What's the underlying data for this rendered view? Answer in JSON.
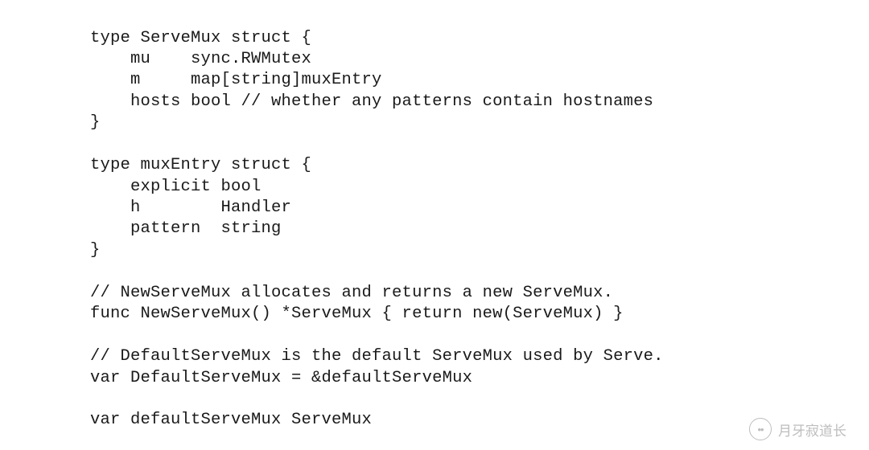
{
  "code": {
    "lines": [
      "type ServeMux struct {",
      "    mu    sync.RWMutex",
      "    m     map[string]muxEntry",
      "    hosts bool // whether any patterns contain hostnames",
      "}",
      "",
      "type muxEntry struct {",
      "    explicit bool",
      "    h        Handler",
      "    pattern  string",
      "}",
      "",
      "// NewServeMux allocates and returns a new ServeMux.",
      "func NewServeMux() *ServeMux { return new(ServeMux) }",
      "",
      "// DefaultServeMux is the default ServeMux used by Serve.",
      "var DefaultServeMux = &defaultServeMux",
      "",
      "var defaultServeMux ServeMux"
    ],
    "full_text": "type ServeMux struct {\n    mu    sync.RWMutex\n    m     map[string]muxEntry\n    hosts bool // whether any patterns contain hostnames\n}\n\ntype muxEntry struct {\n    explicit bool\n    h        Handler\n    pattern  string\n}\n\n// NewServeMux allocates and returns a new ServeMux.\nfunc NewServeMux() *ServeMux { return new(ServeMux) }\n\n// DefaultServeMux is the default ServeMux used by Serve.\nvar DefaultServeMux = &defaultServeMux\n\nvar defaultServeMux ServeMux"
  },
  "watermark": {
    "label": "月牙寂道长",
    "icon_glyph": "✿"
  }
}
